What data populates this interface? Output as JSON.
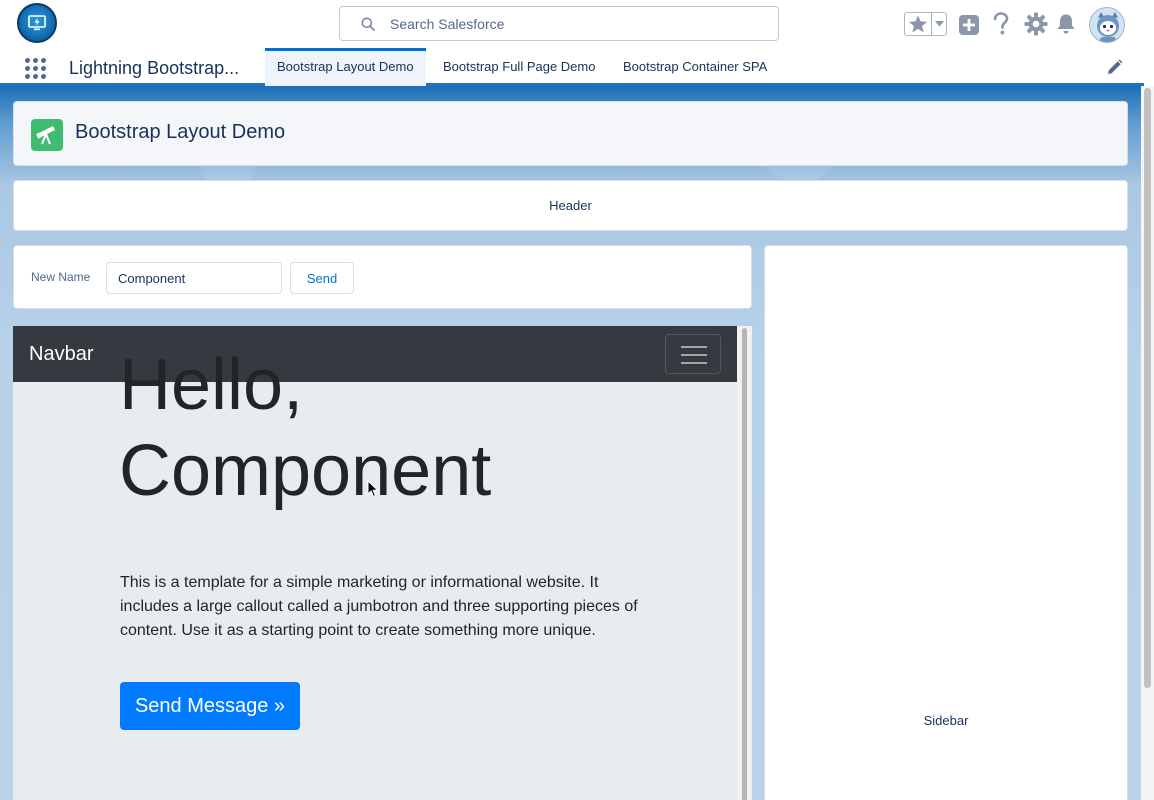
{
  "global_header": {
    "search": {
      "placeholder": "Search Salesforce",
      "icon": "search-icon"
    },
    "icons": [
      "favorites-star-icon",
      "favorites-chevron-icon",
      "global-add-icon",
      "help-icon",
      "setup-gear-icon",
      "notifications-bell-icon",
      "user-avatar"
    ]
  },
  "context_bar": {
    "app_name": "Lightning Bootstrap...",
    "tabs": [
      {
        "label": "Bootstrap Layout Demo",
        "active": true
      },
      {
        "label": "Bootstrap Full Page Demo",
        "active": false
      },
      {
        "label": "Bootstrap Container SPA",
        "active": false
      }
    ]
  },
  "page_header": {
    "title": "Bootstrap Layout Demo",
    "icon": "telescope-icon"
  },
  "header_card": {
    "label": "Header"
  },
  "form": {
    "label": "New Name",
    "value": "Component",
    "button": "Send"
  },
  "sidebar": {
    "label": "Sidebar"
  },
  "bootstrap": {
    "brand": "Navbar",
    "heading_line1": "Hello,",
    "heading_line2": "Component",
    "text": "This is a template for a simple marketing or informational website. It includes a large callout called a jumbotron and three supporting pieces of content. Use it as a starting point to create something more unique.",
    "button": "Send Message »"
  },
  "colors": {
    "brand_blue": "#0070d2",
    "bootstrap_primary": "#007bff",
    "navbar_dark": "#343a40",
    "page_icon_green": "#3fbc6f"
  }
}
